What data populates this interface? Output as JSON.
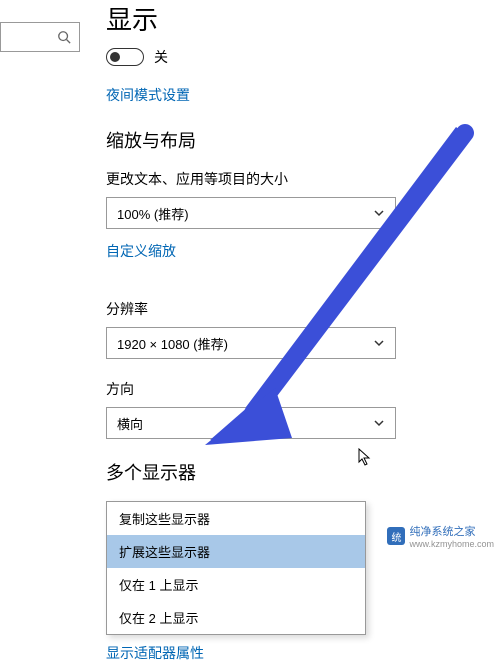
{
  "search": {
    "placeholder": ""
  },
  "page": {
    "title": "显示"
  },
  "nightlight": {
    "toggle_state": "关",
    "settings_link": "夜间模式设置"
  },
  "scale_section": {
    "title": "缩放与布局",
    "text_size_label": "更改文本、应用等项目的大小",
    "text_size_value": "100% (推荐)",
    "custom_scaling_link": "自定义缩放",
    "resolution_label": "分辨率",
    "resolution_value": "1920 × 1080 (推荐)",
    "orientation_label": "方向",
    "orientation_value": "横向"
  },
  "multi_display": {
    "title": "多个显示器",
    "options": [
      "复制这些显示器",
      "扩展这些显示器",
      "仅在 1 上显示",
      "仅在 2 上显示"
    ],
    "selected_index": 1,
    "adapter_link": "显示适配器属性"
  },
  "watermark": {
    "brand": "纯净系统之家",
    "url": "www.kzmyhome.com"
  }
}
